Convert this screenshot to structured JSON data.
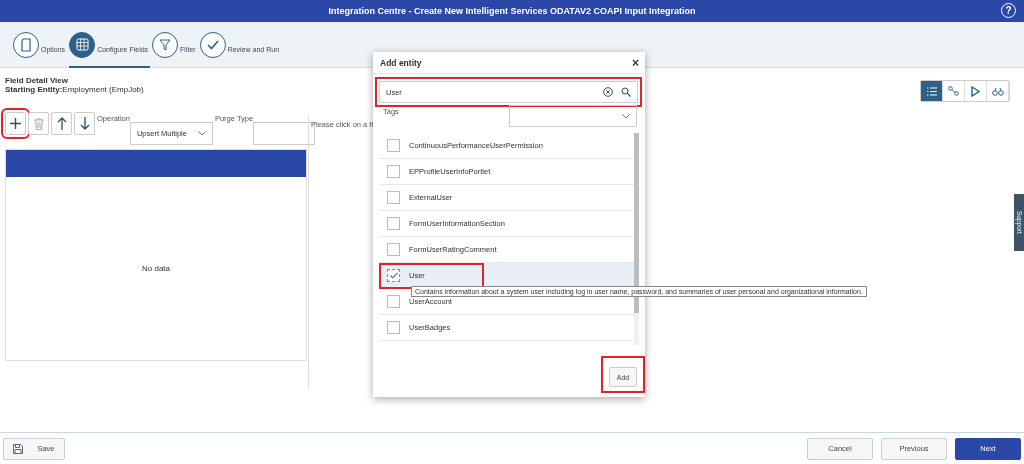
{
  "window": {
    "title": "Integration Centre - Create New Intelligent Services ODATAV2 COAPI Input Integration",
    "help": "?"
  },
  "steps": [
    {
      "label": "Options",
      "selected": false
    },
    {
      "label": "Configure Fields",
      "selected": true
    },
    {
      "label": "Filter",
      "selected": false
    },
    {
      "label": "Review and Run",
      "selected": false
    }
  ],
  "field_detail": {
    "title": "Field Detail View",
    "entity_label": "Starting Entity:",
    "entity_value": "Employment (EmpJob)"
  },
  "toolbar": {
    "buttons": [
      {
        "highlighted": true,
        "disabled": false
      },
      {
        "highlighted": false,
        "disabled": true
      },
      {
        "highlighted": false,
        "disabled": false
      },
      {
        "highlighted": false,
        "disabled": false
      }
    ],
    "operation_label": "Operation",
    "operation_value": "Upsert Multiple",
    "purge_label": "Purge Type",
    "hint": "Please click on a fi"
  },
  "table": {
    "empty_text": "No data"
  },
  "view_buttons": [
    {
      "selected": true
    },
    {
      "selected": false
    },
    {
      "selected": false
    },
    {
      "selected": false
    }
  ],
  "side_tab": "Support",
  "dialog": {
    "title": "Add entity",
    "close": "×",
    "search": {
      "value": "User",
      "highlighted": true
    },
    "tags_label": "Tags",
    "items": [
      {
        "label": "ContinuousPerformanceUserPermission",
        "checked": false,
        "selected": false,
        "highlighted": false
      },
      {
        "label": "EPProfileUserInfoPortlet",
        "checked": false,
        "selected": false,
        "highlighted": false
      },
      {
        "label": "ExternalUser",
        "checked": false,
        "selected": false,
        "highlighted": false
      },
      {
        "label": "FormUserInformationSection",
        "checked": false,
        "selected": false,
        "highlighted": false
      },
      {
        "label": "FormUserRatingComment",
        "checked": false,
        "selected": false,
        "highlighted": false
      },
      {
        "label": "User",
        "checked": true,
        "selected": true,
        "highlighted": true
      },
      {
        "label": "UserAccount",
        "checked": false,
        "selected": false,
        "highlighted": false
      },
      {
        "label": "UserBadges",
        "checked": false,
        "selected": false,
        "highlighted": false
      }
    ],
    "tooltip": "Contains information about a system user including log in user name, password, and summaries of user personal and organizational information.",
    "add_button": {
      "label": "Add",
      "highlighted": true
    }
  },
  "footer": {
    "save": "Save",
    "cancel": "Cancel",
    "previous": "Previous",
    "next": "Next"
  }
}
